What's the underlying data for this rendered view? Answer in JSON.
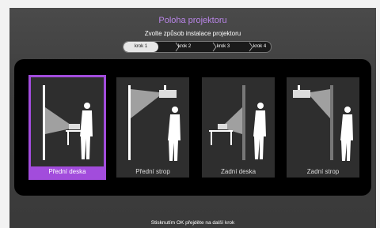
{
  "header": {
    "title": "Poloha projektoru",
    "subtitle": "Zvolte způsob instalace projektoru"
  },
  "steps": [
    {
      "label": "krok 1",
      "active": true
    },
    {
      "label": "krok 2",
      "active": false
    },
    {
      "label": "krok 3",
      "active": false
    },
    {
      "label": "krok 4",
      "active": false
    }
  ],
  "options": [
    {
      "label": "Přední deska",
      "selected": true
    },
    {
      "label": "Přední strop",
      "selected": false
    },
    {
      "label": "Zadní deska",
      "selected": false
    },
    {
      "label": "Zadní strop",
      "selected": false
    }
  ],
  "footer": {
    "hint": "Stisknutím OK přejděte na další krok"
  },
  "colors": {
    "accent": "#a24cdc",
    "title": "#b985e8"
  }
}
